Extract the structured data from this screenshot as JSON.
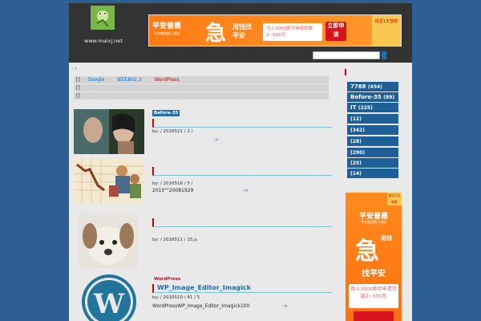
{
  "header": {
    "site_url": "www.maixj.net",
    "logo_icon": "frog-logo-icon"
  },
  "banner": {
    "brand": "平安普惠",
    "sub": "平安集团旗下成员",
    "big": "急",
    "mid": "用钱找平安",
    "box": "月入3000即可申请贷款2~500万",
    "btn": "立即申请",
    "tag": "快至1天放款"
  },
  "search": {
    "placeholder": "..."
  },
  "breadcrumb": ": »",
  "notices": [
    {
      "bullet": "[]",
      "links": [
        "Google",
        "IEEE802.3",
        "WordPress"
      ]
    },
    {
      "bullet": "[]",
      "links": [
        "."
      ]
    },
    {
      "bullet": "[]",
      "links": []
    }
  ],
  "posts": [
    {
      "category": "Before-35",
      "title": "",
      "meta": "by:  / 2016521 / 1 /",
      "excerpt": "",
      "more": "->"
    },
    {
      "category": "",
      "title": "",
      "meta": "by:  / 2016516 / 5 /",
      "excerpt": "2010\"\"20081929",
      "more": "->"
    },
    {
      "category": "",
      "title": "",
      "meta": "by:  / 2016511 / 15 /",
      "excerpt": "",
      "more": "->"
    },
    {
      "category": "WordPress",
      "title": "WP_Image_Editor_Imagick",
      "meta": "by:  / 2016510 / 41 / 5",
      "excerpt": "WordPressWP_Image_Editor_Imagick100",
      "more": "->"
    }
  ],
  "sidebar": {
    "tags": [
      {
        "label": "7788",
        "count": "(454)"
      },
      {
        "label": "Before-35",
        "count": "(89)"
      },
      {
        "label": "IT",
        "count": "(225)"
      },
      {
        "label": "",
        "count": "(12)"
      },
      {
        "label": "",
        "count": "(342)"
      },
      {
        "label": "",
        "count": "(28)"
      },
      {
        "label": "",
        "count": "(290)"
      },
      {
        "label": "",
        "count": "(25)"
      },
      {
        "label": "",
        "count": "(14)"
      }
    ]
  },
  "ad2": {
    "tag": "快至1天放款",
    "brand": "平安普惠",
    "sub": "平安集团旗下成员",
    "big": "急",
    "mid": "用钱",
    "slogan": "找平安",
    "box": "月入3000即可申请贷款2~500万"
  },
  "colors": {
    "background": "#2e5f94",
    "header": "#333333",
    "accent": "#1f5f97",
    "link": "#1a6fb5",
    "wordpress": "#b3121b"
  }
}
